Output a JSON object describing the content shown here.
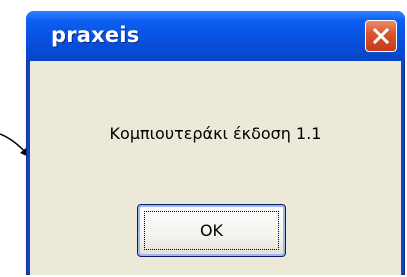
{
  "dialog": {
    "title": "praxeis",
    "message": "Κομπιουτεράκι έκδοση 1.1",
    "ok_label": "OK",
    "close_icon": "close-icon"
  },
  "colors": {
    "titlebar": "#0a50de",
    "close_button": "#d9522d",
    "body_background": "#ece9d8"
  }
}
